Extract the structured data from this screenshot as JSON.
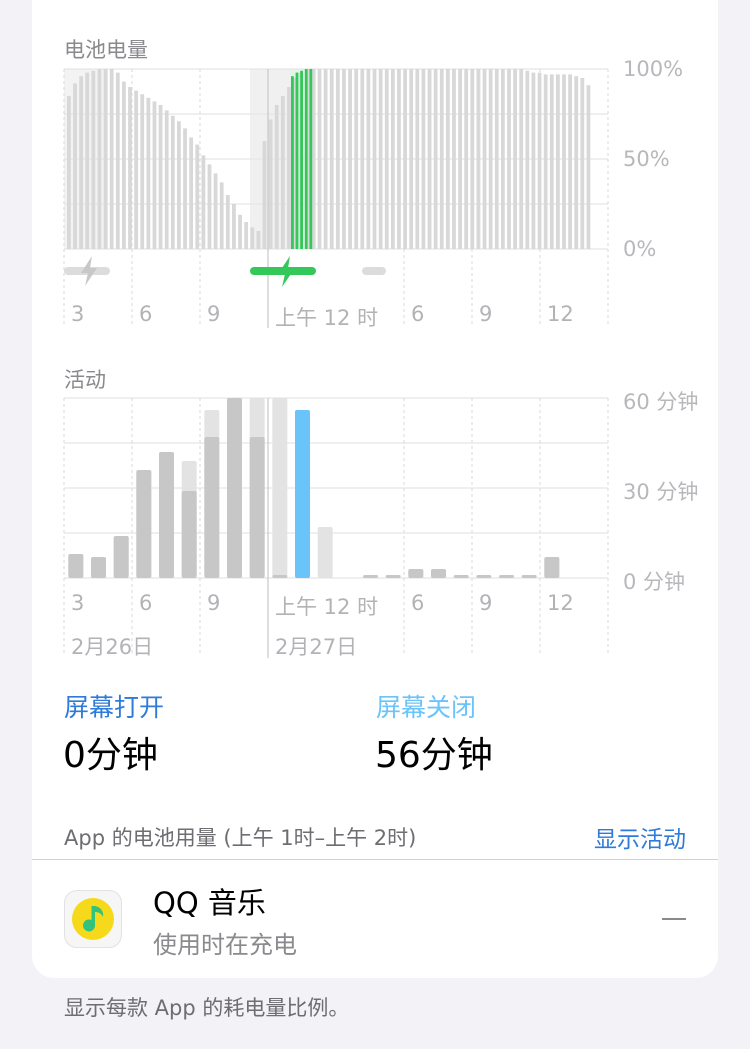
{
  "battery_section": {
    "title": "电池电量",
    "y_ticks": [
      "100%",
      "50%",
      "0%"
    ],
    "x_ticks": [
      "3",
      "6",
      "9",
      "上午 12 时",
      "6",
      "9",
      "12"
    ]
  },
  "activity_section": {
    "title": "活动",
    "y_ticks": [
      "60 分钟",
      "30 分钟",
      "0 分钟"
    ],
    "x_ticks": [
      "3",
      "6",
      "9",
      "上午 12 时",
      "6",
      "9",
      "12"
    ],
    "dates": [
      "2月26日",
      "2月27日"
    ]
  },
  "screen_on": {
    "label": "屏幕打开",
    "value": "0分钟"
  },
  "screen_off": {
    "label": "屏幕关闭",
    "value": "56分钟"
  },
  "usage": {
    "title": "App 的电池用量 (上午 1时–上午 2时)",
    "show_activity": "显示活动"
  },
  "app": {
    "name": "QQ 音乐",
    "status": "使用时在充电"
  },
  "footer": "显示每款 App 的耗电量比例。",
  "colors": {
    "battery_bar": "#d8d8d8",
    "battery_selected": "#34c759",
    "activity_bar": "#c7c7c7",
    "activity_background_bar": "#e3e3e3",
    "activity_selected": "#6ac4fa",
    "blue_label": "#2f7bd9",
    "light_blue_label": "#6ac4fa"
  },
  "chart_data": [
    {
      "type": "bar",
      "title": "电池电量",
      "y_unit": "%",
      "ylim": [
        0,
        100
      ],
      "x_tick_labels": [
        "3",
        "6",
        "9",
        "上午 12 时",
        "6",
        "9",
        "12"
      ],
      "charging_markers": [
        "~上午 3 时",
        "~上午 1 时（当前选中）"
      ],
      "series": [
        {
          "name": "",
          "values": [
            85,
            92,
            96,
            98,
            99,
            100,
            100,
            100,
            98,
            93,
            90,
            88,
            86,
            84,
            82,
            80,
            77,
            74,
            71,
            67,
            62,
            58,
            52,
            47,
            42,
            37,
            30,
            25,
            19,
            15,
            12,
            10,
            60,
            72,
            80,
            85,
            90,
            95,
            98,
            100,
            100,
            100,
            100,
            100,
            100,
            100,
            100,
            100,
            100,
            100,
            100,
            100,
            100,
            100,
            100,
            100,
            100,
            100,
            100,
            100,
            100,
            100,
            100,
            100,
            100,
            100,
            100,
            100,
            100,
            100,
            100,
            100,
            100,
            100,
            100,
            99,
            98,
            98,
            97,
            97,
            97,
            97,
            97,
            96,
            95,
            91
          ]
        }
      ],
      "selected_hour_values": [
        96,
        98,
        99,
        100,
        100
      ]
    },
    {
      "type": "bar",
      "title": "活动",
      "y_unit": "分钟",
      "ylim": [
        0,
        60
      ],
      "x_tick_labels": [
        "3",
        "6",
        "9",
        "上午 12 时",
        "6",
        "9",
        "12"
      ],
      "date_labels": [
        "2月26日",
        "2月27日"
      ],
      "categories": [
        "1",
        "2",
        "3",
        "4",
        "5",
        "6",
        "7",
        "8",
        "9",
        "10",
        "11",
        "12",
        "13",
        "14",
        "15",
        "16",
        "17",
        "18",
        "19",
        "20",
        "21",
        "22",
        "23",
        "24"
      ],
      "series": [
        {
          "name": "屏幕打开",
          "values": [
            8,
            7,
            14,
            36,
            42,
            29,
            47,
            60,
            47,
            1,
            0,
            0,
            0,
            1,
            1,
            3,
            3,
            1,
            1,
            1,
            1,
            7,
            0,
            0
          ]
        },
        {
          "name": "屏幕关闭",
          "values": [
            0,
            0,
            0,
            0,
            0,
            10,
            9,
            0,
            13,
            59,
            56,
            17,
            0,
            0,
            0,
            0,
            0,
            0,
            0,
            0,
            0,
            0,
            0,
            0
          ]
        }
      ],
      "selected_category": "11"
    }
  ]
}
